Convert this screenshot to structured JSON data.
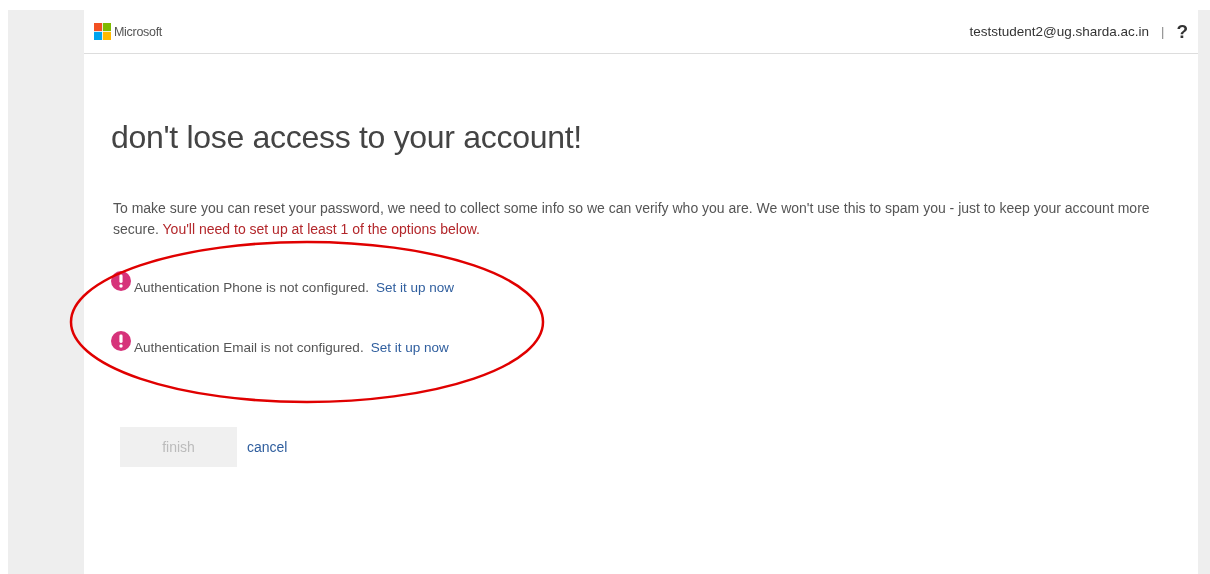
{
  "header": {
    "logo_text": "Microsoft",
    "account": "teststudent2@ug.sharda.ac.in",
    "separator": "|",
    "help": "?"
  },
  "page": {
    "title": "don't lose access to your account!",
    "intro": "To make sure you can reset your password, we need to collect some info so we can verify who you are. We won't use this to spam you - just to keep your account more secure.",
    "warning": "You'll need to set up at least 1 of the options below.",
    "methods": [
      {
        "text": "Authentication Phone is not configured.",
        "link": "Set it up now",
        "configured": false
      },
      {
        "text": "Authentication Email is not configured.",
        "link": "Set it up now",
        "configured": false
      }
    ],
    "buttons": [
      {
        "label": "finish",
        "kind": "button",
        "disabled": true
      },
      {
        "label": "cancel",
        "kind": "link",
        "disabled": false
      }
    ]
  },
  "annotations": [
    {
      "kind": "ellipse"
    }
  ]
}
